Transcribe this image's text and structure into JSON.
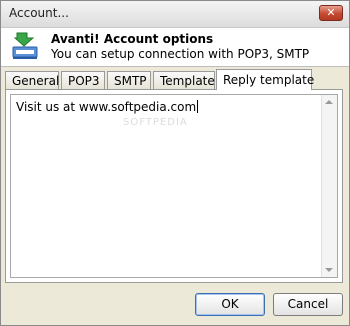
{
  "window": {
    "title": "Account..."
  },
  "header": {
    "title": "Avanti! Account options",
    "subtitle": "You can setup connection with POP3, SMTP"
  },
  "tabs": [
    {
      "label": "General"
    },
    {
      "label": "POP3"
    },
    {
      "label": "SMTP"
    },
    {
      "label": "Template"
    },
    {
      "label": "Reply template",
      "active": true
    }
  ],
  "editor": {
    "value": "Visit us at www.softpedia.com",
    "watermark": "SOFTPEDIA"
  },
  "buttons": {
    "ok": "OK",
    "cancel": "Cancel"
  },
  "icons": {
    "close": "close-icon",
    "account": "account-setup-icon"
  },
  "colors": {
    "close_button": "#c44a30",
    "icon_green": "#3aa64a",
    "icon_blue": "#2f6fc8"
  }
}
